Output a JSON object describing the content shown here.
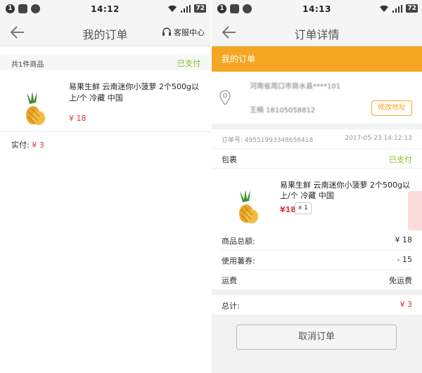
{
  "left": {
    "status": {
      "badge": "1",
      "time": "14:12",
      "battery": "72"
    },
    "nav": {
      "title": "我的订单",
      "service_label": "客服中心"
    },
    "summary": {
      "count_label": "共1件商品",
      "status": "已支付"
    },
    "item": {
      "name": "易果生鲜 云南迷你小菠萝 2个500g以上/个 冷藏 中国",
      "price": "¥ 18"
    },
    "total": {
      "label": "实付:",
      "value": "¥ 3"
    }
  },
  "right": {
    "status": {
      "badge": "1",
      "time": "14:13",
      "battery": "72"
    },
    "nav": {
      "title": "订单详情"
    },
    "section_title": "我的订单",
    "address": {
      "line": "河南省周口市商水县****101",
      "contact": "王楠 18105058812",
      "edit_label": "修改地址"
    },
    "order": {
      "number": "订单号: 49551993348656418",
      "date": "2017-05-23 14:12:13"
    },
    "package": {
      "label": "包裹",
      "status": "已支付"
    },
    "item": {
      "name": "易果生鲜 云南迷你小菠萝 2个500g以上/个 冷藏 中国",
      "price": "¥18",
      "qty": "x 1"
    },
    "sums": [
      {
        "label": "商品总额:",
        "value": "¥ 18"
      },
      {
        "label": "使用薯券:",
        "value": "- 15"
      },
      {
        "label": "运费",
        "value": "免运费"
      }
    ],
    "total": {
      "label": "总计:",
      "value": "¥ 3"
    },
    "cancel_label": "取消订单"
  },
  "colors": {
    "accent": "#f5a623",
    "paid_green": "#7bbf1e",
    "price_red": "#e8323c"
  },
  "icons": [
    "back-arrow-icon",
    "headset-icon",
    "location-pin-icon",
    "wifi-icon",
    "signal-icon",
    "pineapple-image"
  ]
}
